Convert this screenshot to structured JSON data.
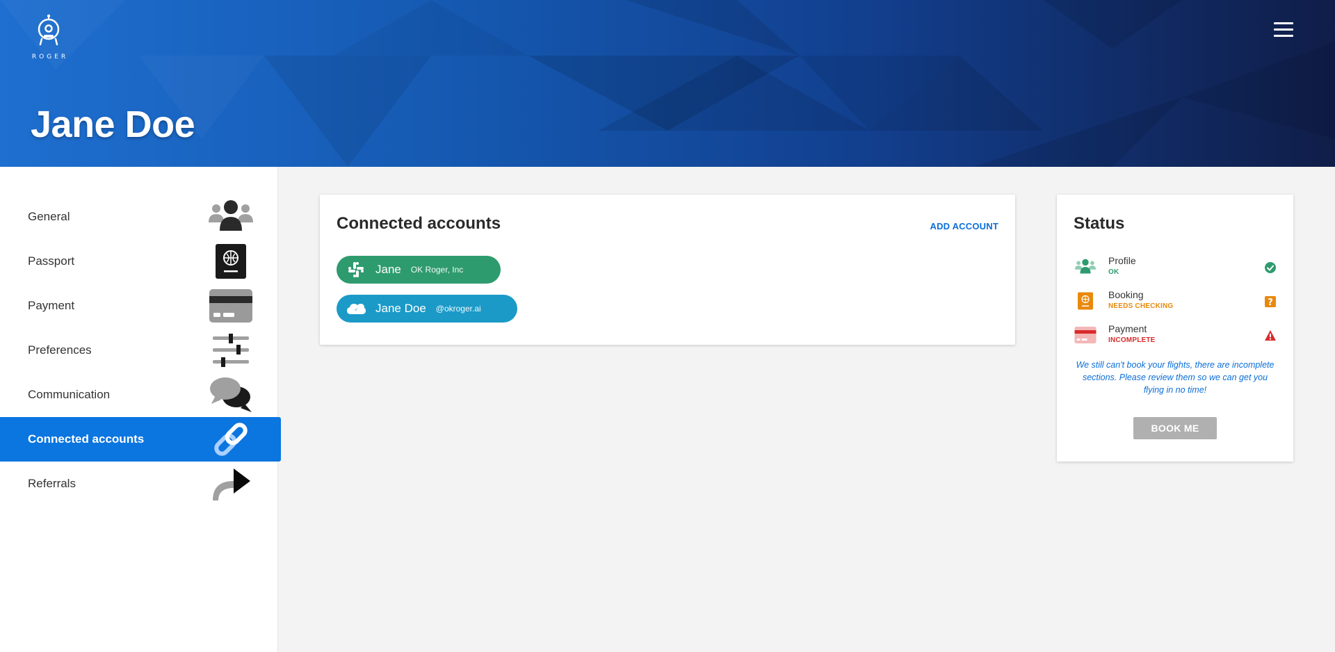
{
  "app": {
    "logo_text": "ROGER",
    "menu_icon": "hamburger-menu-icon"
  },
  "profile": {
    "name": "Jane Doe"
  },
  "sidebar": {
    "items": [
      {
        "label": "General",
        "icon": "group-icon",
        "active": false
      },
      {
        "label": "Passport",
        "icon": "passport-icon",
        "active": false
      },
      {
        "label": "Payment",
        "icon": "credit-card-icon",
        "active": false
      },
      {
        "label": "Preferences",
        "icon": "sliders-icon",
        "active": false
      },
      {
        "label": "Communication",
        "icon": "chat-bubbles-icon",
        "active": false
      },
      {
        "label": "Connected accounts",
        "icon": "link-icon",
        "active": true
      },
      {
        "label": "Referrals",
        "icon": "share-arrow-icon",
        "active": false
      }
    ]
  },
  "accounts": {
    "title": "Connected accounts",
    "add_label": "ADD ACCOUNT",
    "list": [
      {
        "service": "Slack",
        "icon": "slack-icon",
        "name": "Jane",
        "detail": "OK Roger, Inc",
        "color": "#2e9b6e"
      },
      {
        "service": "Salesforce",
        "icon": "salesforce-cloud-icon",
        "name": "Jane Doe",
        "detail": "@okroger.ai",
        "color": "#1b9ac8"
      }
    ]
  },
  "status": {
    "title": "Status",
    "items": [
      {
        "name": "Profile",
        "state": "OK",
        "state_color": "#2e9b6e",
        "badge": "check-circle-icon"
      },
      {
        "name": "Booking",
        "state": "NEEDS CHECKING",
        "state_color": "#e8890c",
        "badge": "question-square-icon"
      },
      {
        "name": "Payment",
        "state": "INCOMPLETE",
        "state_color": "#d92b2b",
        "badge": "warning-triangle-icon"
      }
    ],
    "note": "We still can't book your flights, there are incomplete sections. Please review them so we can get you flying in no time!",
    "button_label": "BOOK ME"
  },
  "colors": {
    "accent": "#0b75e0",
    "header_start": "#1e6fd0",
    "header_end": "#101d48"
  }
}
